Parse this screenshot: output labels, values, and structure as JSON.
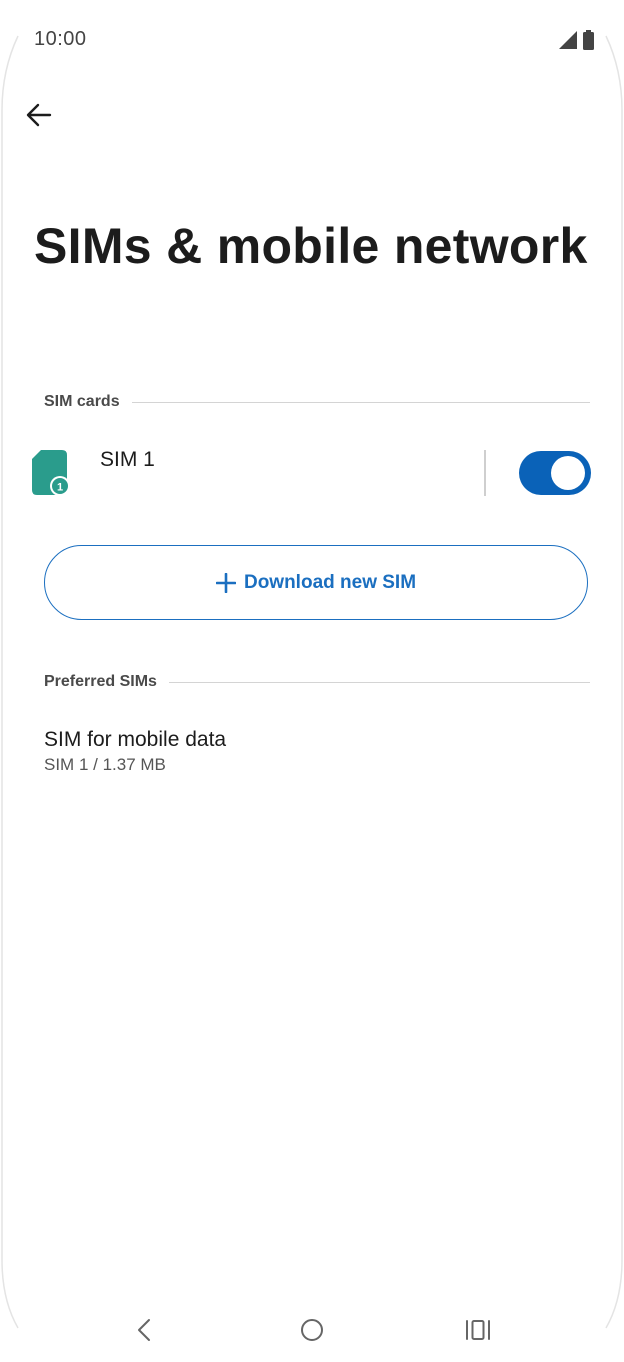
{
  "status_bar": {
    "time": "10:00",
    "icons": [
      "signal-icon",
      "battery-icon"
    ]
  },
  "header": {
    "back_icon": "arrow-left-icon",
    "title": "SIMs & mobile network"
  },
  "sim_cards": {
    "section_label": "SIM cards",
    "items": [
      {
        "label": "SIM 1",
        "badge": "1",
        "enabled": true,
        "icon": "sim-card-icon"
      }
    ],
    "download_button": {
      "label": "Download new SIM",
      "icon": "plus-icon"
    }
  },
  "preferred_sims": {
    "section_label": "Preferred SIMs",
    "items": [
      {
        "title": "SIM for mobile data",
        "subtitle": "SIM 1 / 1.37 MB"
      }
    ]
  },
  "navigation": {
    "back_icon": "nav-back-icon",
    "home_icon": "nav-home-icon",
    "recents_icon": "nav-recents-icon"
  },
  "colors": {
    "accent": "#0a62b8",
    "button_text": "#1b6fc0",
    "sim_icon": "#2a9c8c"
  }
}
